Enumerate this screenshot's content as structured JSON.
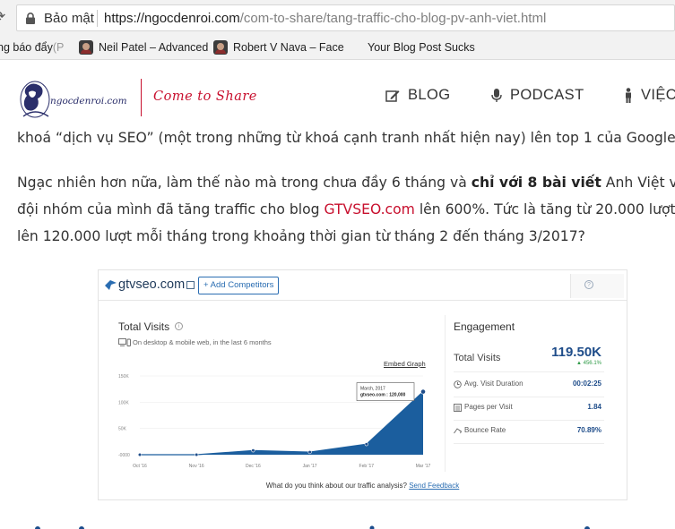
{
  "browser": {
    "security_label": "Bảo mật",
    "url_host": "https://ngocdenroi.com",
    "url_path": "/com-to-share/tang-traffic-cho-blog-pv-anh-viet.html",
    "bookmarks": [
      {
        "label": "ng báo đẩy",
        "fade": " (P"
      },
      {
        "label": "Neil Patel – Advanced",
        "fade": ""
      },
      {
        "label": "Robert V Nava – Face",
        "fade": ""
      },
      {
        "label": "Your Blog Post Sucks",
        "fade": ""
      }
    ]
  },
  "header": {
    "logo_text": "ngocdenroi.com",
    "tagline": "Come to Share",
    "nav": [
      {
        "label": "BLOG",
        "icon": "edit-icon"
      },
      {
        "label": "PODCAST",
        "icon": "microphone-icon"
      },
      {
        "label": "VIỆC",
        "icon": "person-icon"
      }
    ]
  },
  "article": {
    "line1": "khoá “dịch vụ SEO” (một trong những từ khoá cạnh tranh nhất hiện nay) lên top 1 của Google",
    "p2_a": "Ngạc nhiên hơn nữa, làm thế nào mà trong chưa đầy 6 tháng và ",
    "p2_bold": "chỉ với 8 bài viết",
    "p2_b": " Anh Việt và",
    "p2_line2_a": "đội nhóm của mình đã tăng traffic cho blog ",
    "p2_link": "GTVSEO.com",
    "p2_line2_b": " lên 600%. Tức là tăng từ 20.000 lượt",
    "p2_line3": "lên 120.000 lượt mỗi tháng trong khoảng thời gian từ tháng 2 đến tháng 3/2017?"
  },
  "similarweb": {
    "domain": "gtvseo.com",
    "add_competitors": "+ Add Competitors",
    "help": "?",
    "total_visits_title": "Total Visits",
    "info": "i",
    "device_note": "On desktop & mobile web, in the last 6 months",
    "embed_graph": "Embed Graph",
    "tooltip_month": "March, 2017",
    "tooltip_value": "gtvseo.com : 120,000",
    "engagement_title": "Engagement",
    "total_visits_label": "Total Visits",
    "total_visits_value": "119.50K",
    "total_visits_change": "▲ 456.1%",
    "metrics": [
      {
        "label": "Avg. Visit Duration",
        "value": "00:02:25",
        "icon": "clock-icon"
      },
      {
        "label": "Pages per Visit",
        "value": "1.84",
        "icon": "pages-icon"
      },
      {
        "label": "Bounce Rate",
        "value": "70.89%",
        "icon": "bounce-icon"
      }
    ],
    "feedback_text": "What do you think about our traffic analysis? ",
    "feedback_link": "Send Feedback"
  },
  "chart_data": {
    "type": "area",
    "title": "Total Visits",
    "categories": [
      "Oct '16",
      "Nov '16",
      "Dec '16",
      "Jan '17",
      "Feb '17",
      "Mar '17"
    ],
    "values": [
      0,
      0,
      8000,
      5000,
      20000,
      120000
    ],
    "y_ticks": [
      "150K",
      "100K",
      "50K",
      "-0000"
    ],
    "ylim": [
      0,
      150000
    ],
    "grid": true,
    "colors": {
      "fill": "#1b5e9e",
      "line": "#1b5e9e",
      "point": "#1f4d8a"
    }
  }
}
